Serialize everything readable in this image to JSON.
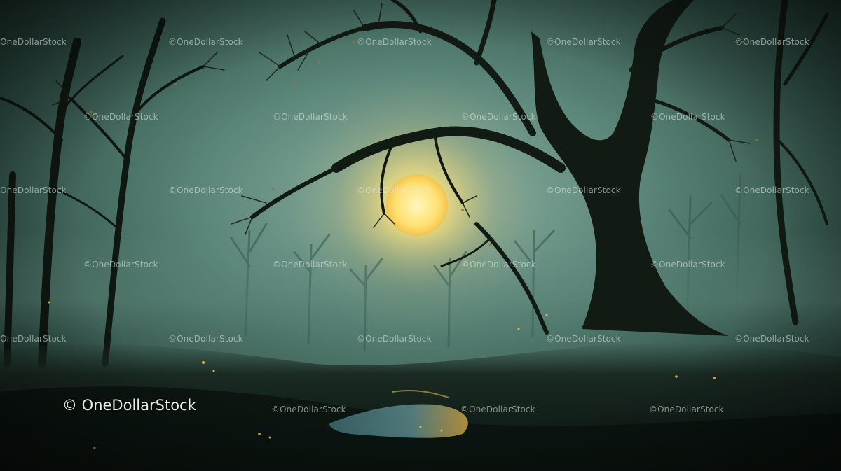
{
  "scene": {
    "description_free": true,
    "palette": {
      "sky": "#5e8a80",
      "fog": "#4d7469",
      "moon": "#ffe27a",
      "ground": "#0f1c17",
      "tree": "#10150f",
      "glow": "#f0b040"
    }
  },
  "watermark": {
    "tile_text": "©OneDollarStock",
    "main_text": "© OneDollarStock"
  }
}
